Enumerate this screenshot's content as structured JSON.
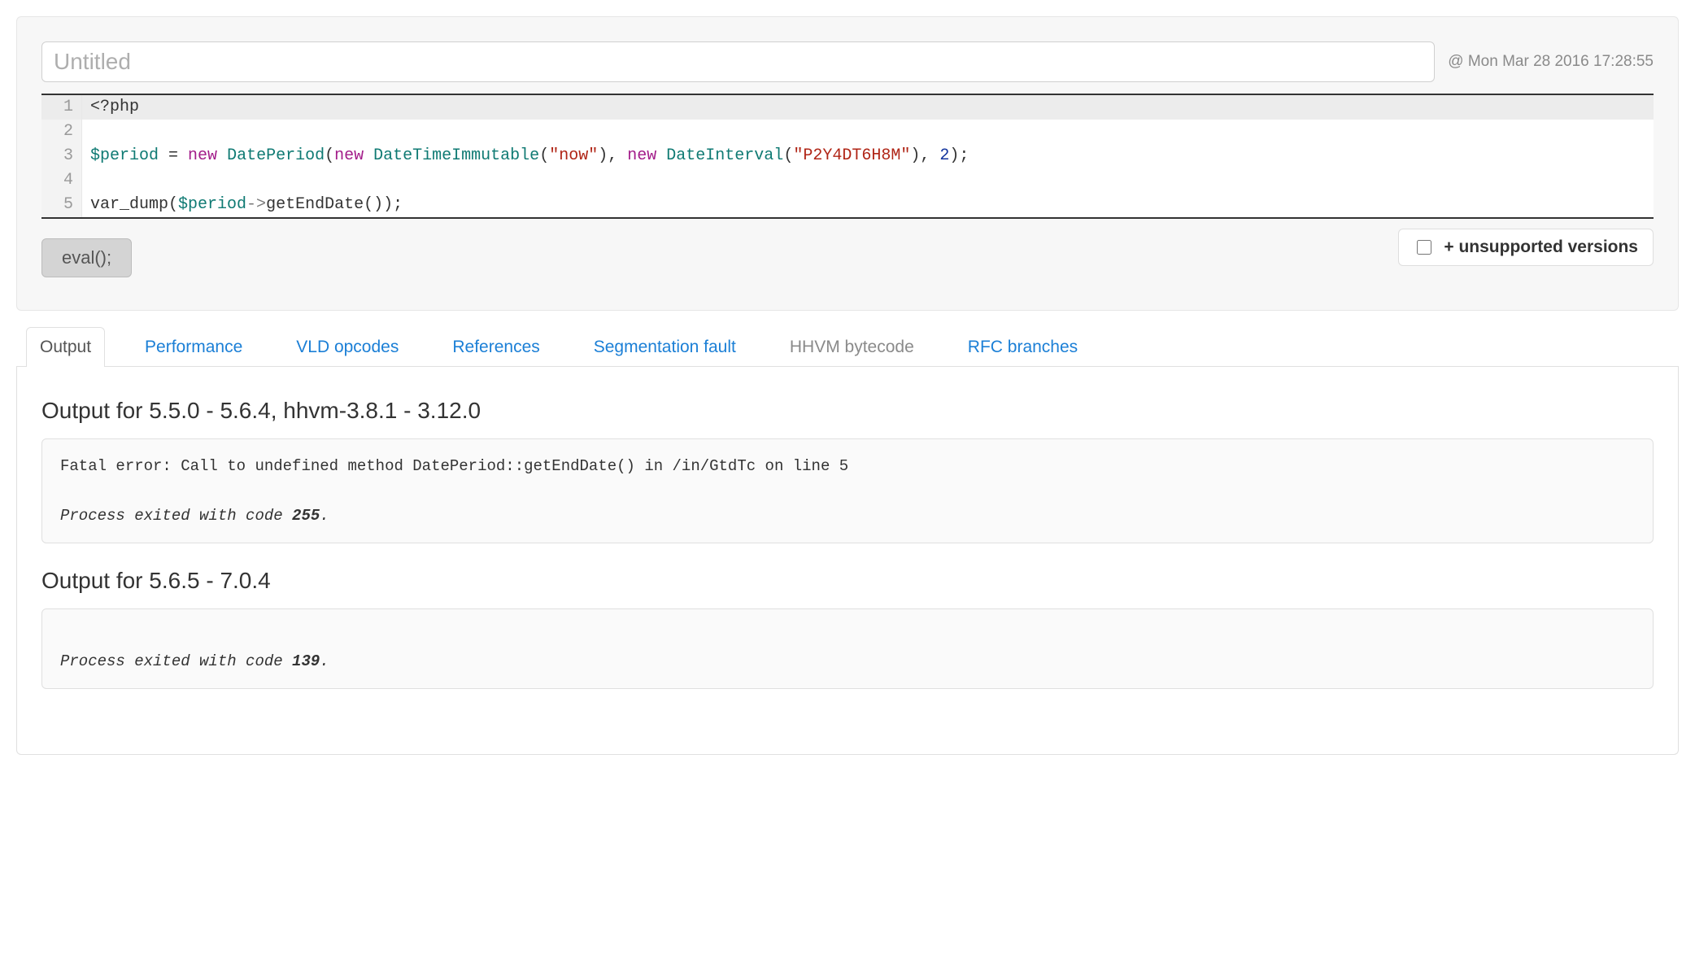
{
  "header": {
    "title_placeholder": "Untitled",
    "title_value": "",
    "timestamp_prefix": "@ ",
    "timestamp": "Mon Mar 28 2016 17:28:55"
  },
  "code": {
    "line1": {
      "open_tag": "<?php"
    },
    "line3": {
      "var": "$period",
      "eq": " = ",
      "new1": "new",
      "sp1": " ",
      "cls1": "DatePeriod",
      "lp1": "(",
      "new2": "new",
      "sp2": " ",
      "cls2": "DateTimeImmutable",
      "lp2": "(",
      "str1": "\"now\"",
      "rp2": ")",
      "comma1": ", ",
      "new3": "new",
      "sp3": " ",
      "cls3": "DateInterval",
      "lp3": "(",
      "str2": "\"P2Y4DT6H8M\"",
      "rp3": ")",
      "comma2": ", ",
      "num": "2",
      "rp1": ")",
      "semi": ";"
    },
    "line5": {
      "func": "var_dump",
      "lp": "(",
      "var": "$period",
      "arrow": "->",
      "method": "getEndDate",
      "call": "()",
      "rp": ")",
      "semi": ";"
    },
    "linenos": {
      "n1": "1",
      "n2": "2",
      "n3": "3",
      "n4": "4",
      "n5": "5"
    }
  },
  "controls": {
    "eval_label": "eval();",
    "unsupported_label": "+ unsupported versions"
  },
  "tabs": {
    "output": "Output",
    "performance": "Performance",
    "vld": "VLD opcodes",
    "references": "References",
    "segfault": "Segmentation fault",
    "hhvm": "HHVM bytecode",
    "rfc": "RFC branches"
  },
  "output": {
    "sections": [
      {
        "heading": "Output for 5.5.0 - 5.6.4, hhvm-3.8.1 - 3.12.0",
        "body": "Fatal error: Call to undefined method DatePeriod::getEndDate() in /in/GtdTc on line 5",
        "exit_prefix": "Process exited with code ",
        "exit_code": "255",
        "exit_suffix": "."
      },
      {
        "heading": "Output for 5.6.5 - 7.0.4",
        "body": "",
        "exit_prefix": "Process exited with code ",
        "exit_code": "139",
        "exit_suffix": "."
      }
    ]
  }
}
